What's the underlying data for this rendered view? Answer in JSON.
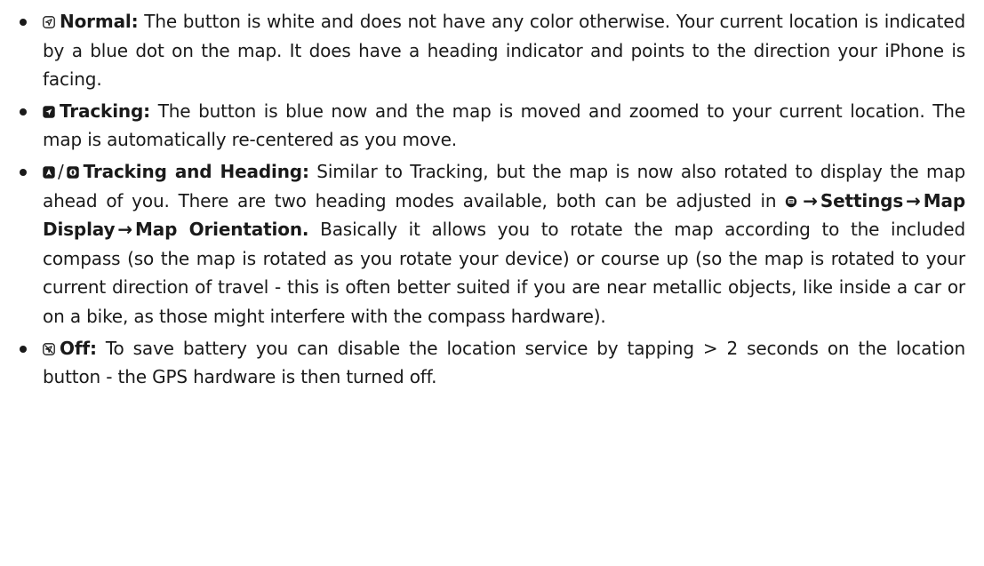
{
  "modes": [
    {
      "name": "Normal:",
      "icon": "location-arrow-outline-icon",
      "text": "The button is white and does not have any color otherwise. Your current location is indicated by a blue dot on the map. It does have a heading indicator and points to the direction your iPhone is facing."
    },
    {
      "name": "Tracking:",
      "icon": "location-arrow-filled-icon",
      "text": "The button is blue now and the map is moved and zoomed to your current location. The map is automatically re-centered as you move."
    },
    {
      "name": "Tracking and Heading:",
      "icons": [
        "heading-arrow-filled-icon",
        "heading-compass-filled-icon"
      ],
      "separator": "/",
      "text_before": "Similar to Tracking, but the map is now also rotated to display the map ahead of you. There are two heading modes available, both can be adjusted in",
      "menu_icon": "menu-icon",
      "path": [
        "Settings",
        "Map Display",
        "Map Orientation."
      ],
      "arrow": "→",
      "text_after": "Basically it allows you to rotate the map according to the included compass (so the map is rotated as you rotate your device) or course up (so the map is rotated to your current direction of travel - this is often better suited if you are near metallic objects, like inside a car or on a bike, as those might interfere with the compass hardware)."
    },
    {
      "name": "Off:",
      "icon": "location-off-icon",
      "text": "To save battery you can disable the location service by tapping > 2 seconds on the location button - the GPS hardware is then turned off."
    }
  ]
}
